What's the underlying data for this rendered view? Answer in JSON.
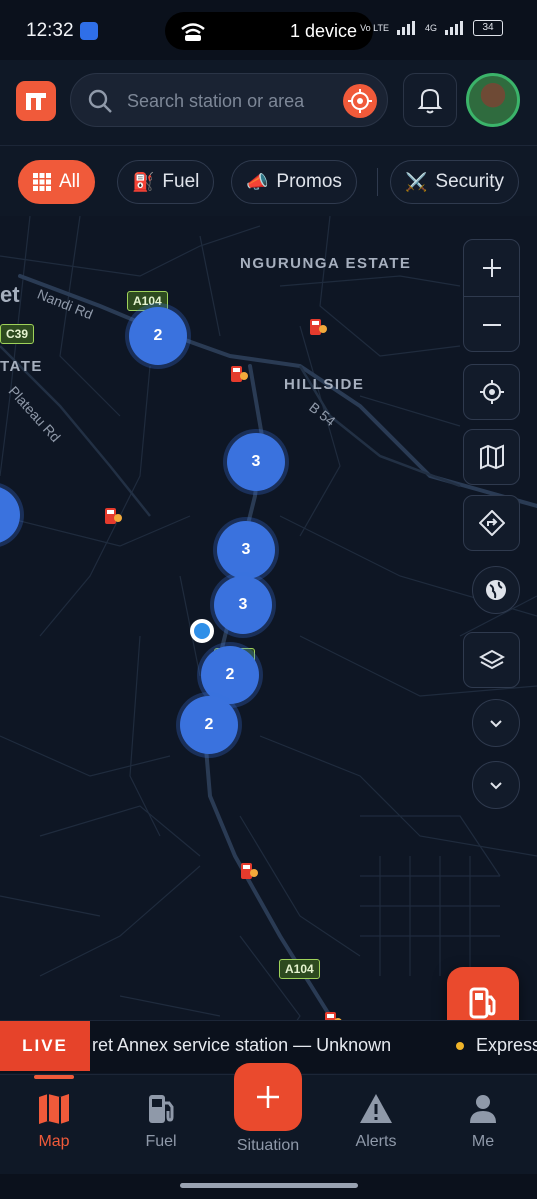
{
  "status_bar": {
    "time": "12:32",
    "center_pill": "1 device",
    "network_left": "Vo LTE",
    "network_right": "4G",
    "battery": "34"
  },
  "header": {
    "logo_icon": "brand-logo-icon",
    "search_placeholder": "Search station or area",
    "locate_icon": "target-icon",
    "bell_icon": "bell-icon",
    "avatar_icon": "user-photo"
  },
  "filters": [
    {
      "label": "All",
      "icon": "grid-icon",
      "active": true
    },
    {
      "label": "Fuel",
      "icon": "fuel-pump-icon",
      "active": false
    },
    {
      "label": "Promos",
      "icon": "megaphone-icon",
      "active": false
    },
    {
      "label": "Security",
      "icon": "crossed-swords-icon",
      "active": false
    }
  ],
  "map": {
    "area_labels": [
      "NGURUNGA ESTATE",
      "HILLSIDE",
      "TATE",
      "et"
    ],
    "road_labels": [
      "Nandi Rd",
      "Plateau Rd",
      "B 54"
    ],
    "shields": [
      "A104",
      "C39",
      "A104",
      "A104"
    ],
    "clusters": [
      "2",
      "3",
      "3",
      "3",
      "2",
      "2"
    ],
    "controls": [
      "zoom-in",
      "zoom-out",
      "my-location",
      "map-view",
      "directions",
      "globe",
      "layers",
      "chevron-down",
      "chevron-down"
    ],
    "accent": "#f05a3a",
    "cluster_color": "#3a72de"
  },
  "ticker": {
    "live_label": "LIVE",
    "text": "ret Annex service station — Unknown",
    "next_text": "Express"
  },
  "nav": {
    "tabs": [
      {
        "label": "Map",
        "icon": "map-icon",
        "active": true
      },
      {
        "label": "Fuel",
        "icon": "fuel-pump-icon",
        "active": false
      },
      {
        "label": "Situation",
        "icon": "plus-icon",
        "active": false
      },
      {
        "label": "Alerts",
        "icon": "warning-icon",
        "active": false
      },
      {
        "label": "Me",
        "icon": "person-icon",
        "active": false
      }
    ]
  }
}
